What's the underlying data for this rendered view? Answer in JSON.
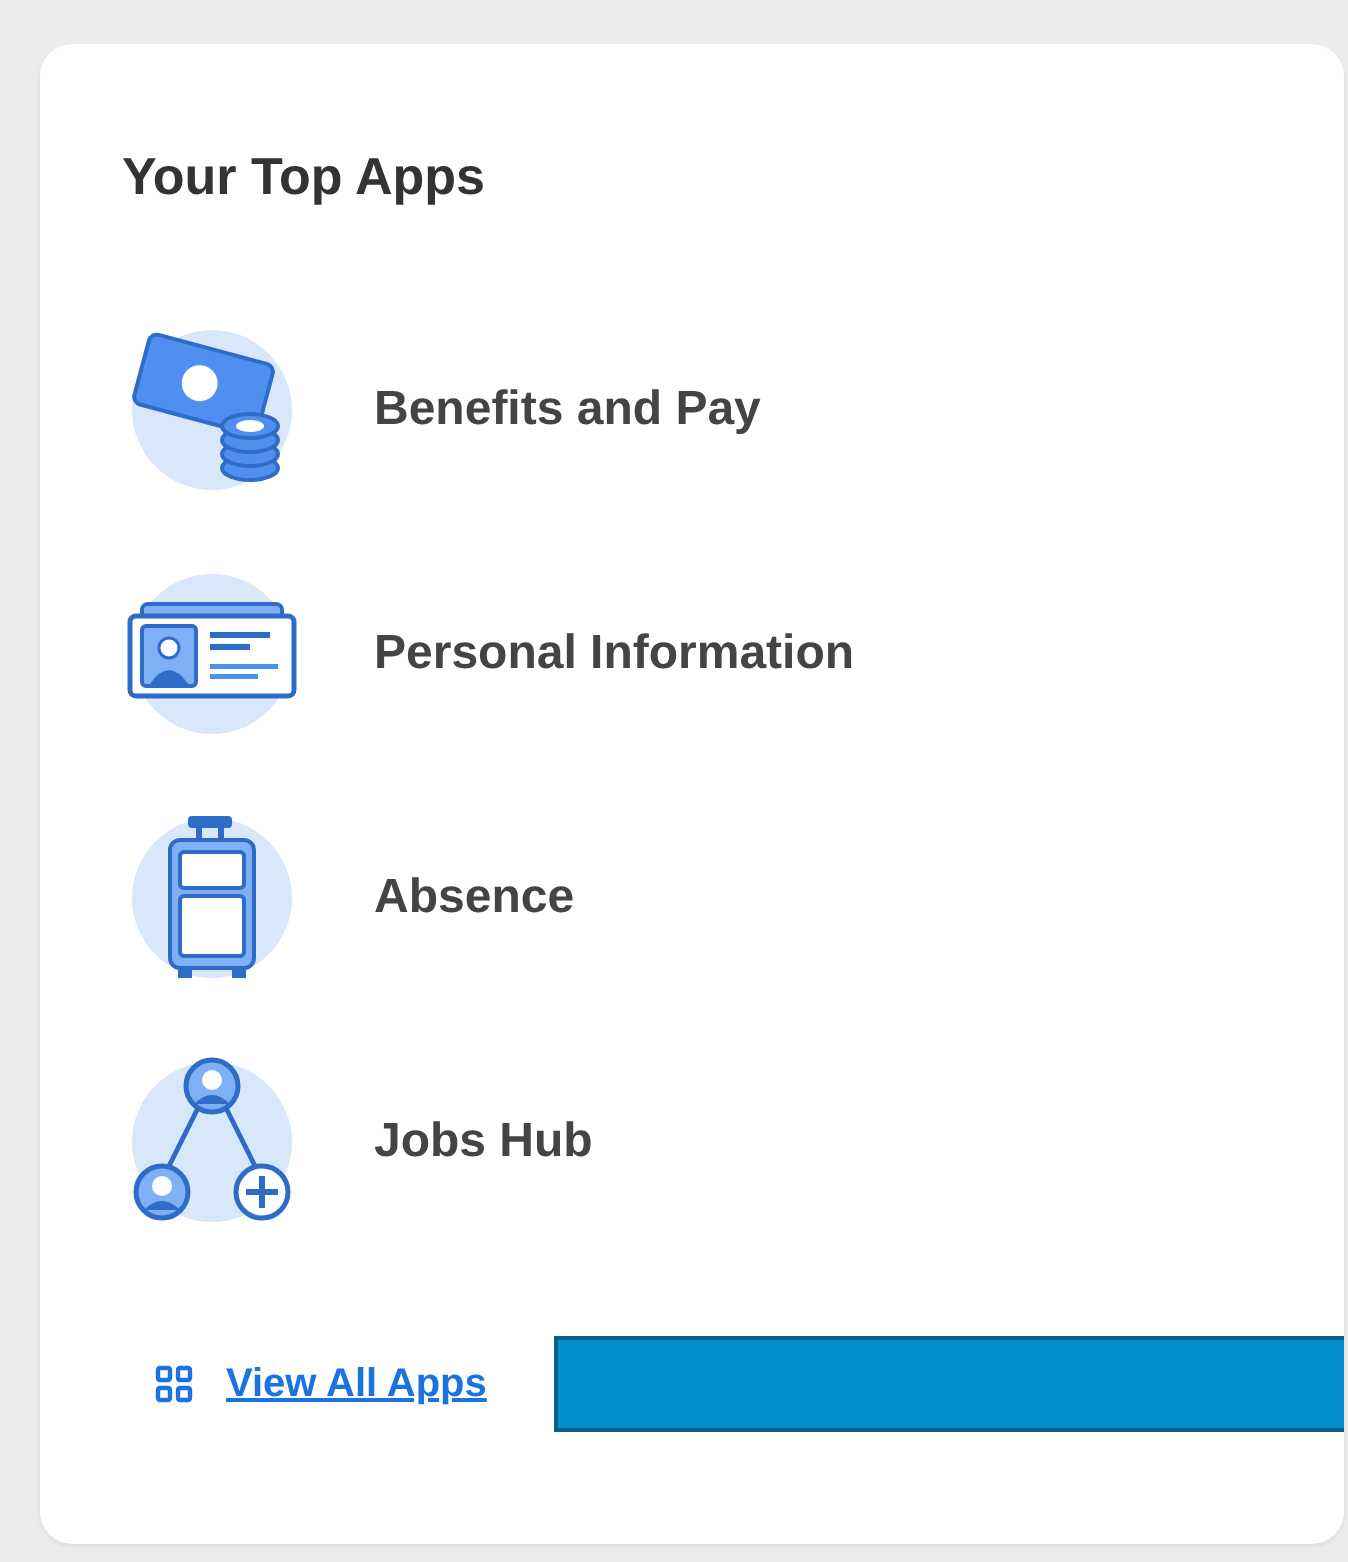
{
  "card": {
    "title": "Your Top Apps",
    "apps": [
      {
        "label": "Benefits and Pay"
      },
      {
        "label": "Personal Information"
      },
      {
        "label": "Absence"
      },
      {
        "label": "Jobs Hub"
      }
    ],
    "footer_link": "View All Apps"
  }
}
